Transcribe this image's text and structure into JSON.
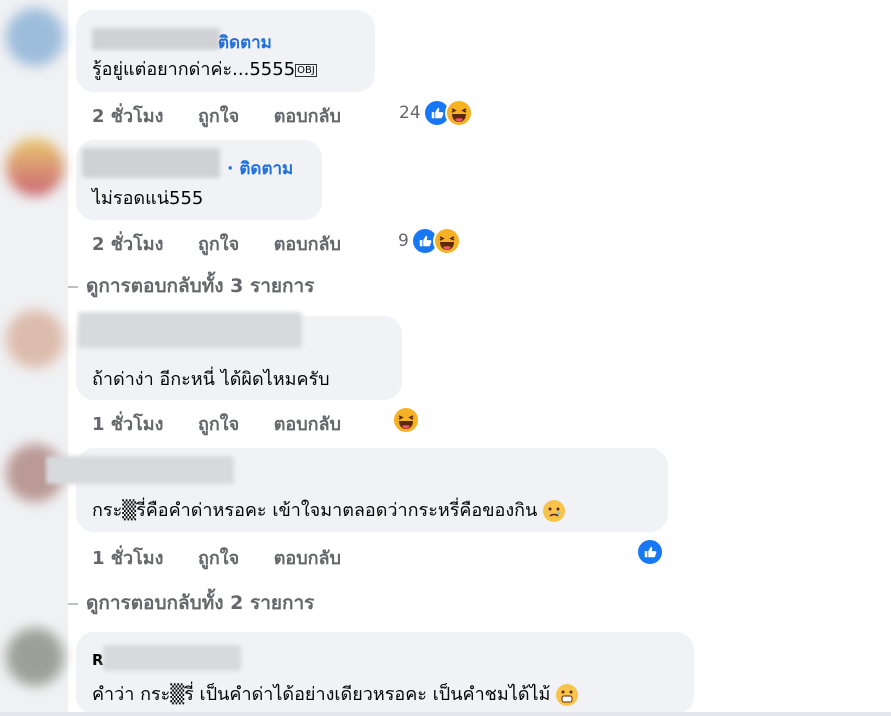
{
  "comments": [
    {
      "follow": "ติดตาม",
      "text": "รู้อยู่แต่อยากด่าค่ะ...5555",
      "obj": "OBJ",
      "time": "2 ชั่วโมง",
      "like": "ถูกใจ",
      "reply": "ตอบกลับ",
      "reaction_count": "24"
    },
    {
      "follow": "· ติดตาม",
      "text": "ไม่รอดแน่555",
      "time": "2 ชั่วโมง",
      "like": "ถูกใจ",
      "reply": "ตอบกลับ",
      "reaction_count": "9"
    },
    {
      "text": "ถ้าด่าง่า อีกะหนี่ ได้ผิดไหมครับ",
      "time": "1 ชั่วโมง",
      "like": "ถูกใจ",
      "reply": "ตอบกลับ"
    },
    {
      "text": "กระ▒รี่คือคำด่าหรอคะ เข้าใจมาตลอดว่ากระหรี่คือของกิน",
      "time": "1 ชั่วโมง",
      "like": "ถูกใจ",
      "reply": "ตอบกลับ"
    },
    {
      "name_initial": "R",
      "text": "คำว่า กระ▒รี่ เป็นคำด่าได้อย่างเดียวหรอคะ เป็นคำชมได้ไม้"
    }
  ],
  "view_replies": [
    "ดูการตอบกลับทั้ง 3 รายการ",
    "ดูการตอบกลับทั้ง 2 รายการ"
  ],
  "colors": {
    "bubble": "#f0f2f5",
    "link_blue": "#216fdb",
    "meta_gray": "#65676b",
    "like_blue": "#1877f2",
    "haha_yellow": "#f7b125"
  }
}
